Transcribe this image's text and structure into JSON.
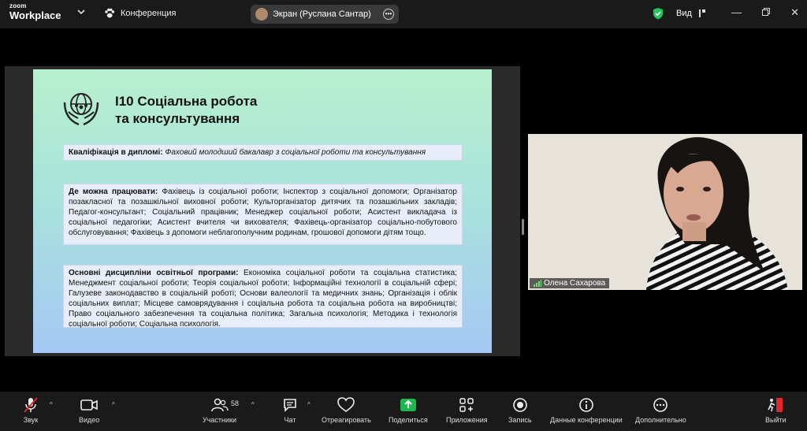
{
  "app": {
    "brand_small": "zoom",
    "brand_large": "Workplace",
    "meeting_title": "Конференция",
    "screen_share_label": "Экран (Руслана Сантар)",
    "view_label": "Вид"
  },
  "slide": {
    "title_line1": "І10 Соціальна робота",
    "title_line2": "та консультування",
    "qual_label": "Кваліфікація в дипломі:",
    "qual_text": "Фаховий молодший бакалавр з соціальної роботи та консультування",
    "work_label": "Де можна працювати:",
    "work_text": "Фахівець із соціальної роботи; Інспектор з соціальної допомоги; Організатор позакласної та позашкільної виховної роботи; Культорганізатор дитячих та позашкільних закладів; Педагог-консультант; Соціальний працівник; Менеджер соціальної роботи; Асистент викладача із соціальної педагогіки; Асистент вчителя чи вихователя; Фахівець-організатор соціально-побутового обслуговування; Фахівець з допомоги неблагополучним родинам, грошової допомоги дітям тощо.",
    "disc_label": "Основні дисципліни освітньої програми:",
    "disc_text": "Економіка соціальної роботи та соціальна статистика; Менеджмент соціальної роботи; Теорія соціальної роботи; Інформаційні технології в соціальній сфері; Галузеве законодавство в соціальній роботі; Основи валеології та медичних знань; Організація і облік соціальних виплат; Місцеве самоврядування і соціальна робота та соціальна робота на виробництві; Право соціального забезпечення та соціальна політика; Загальна психологія; Методика і технологія соціальної роботи; Соціальна психологія."
  },
  "video": {
    "participant_name": "Олена Сахарова"
  },
  "toolbar": {
    "audio": "Звук",
    "video": "Видео",
    "participants": "Участники",
    "participants_count": "58",
    "chat": "Чат",
    "react": "Отреагировать",
    "share": "Поделиться",
    "apps": "Приложения",
    "record": "Запись",
    "info": "Данные конференции",
    "more": "Дополнительно",
    "leave": "Выйти"
  },
  "colors": {
    "toolbar_bg": "#1a1a1a",
    "share_green": "#1fb84f",
    "leave_red": "#e02828",
    "shield_green": "#22c55e"
  }
}
